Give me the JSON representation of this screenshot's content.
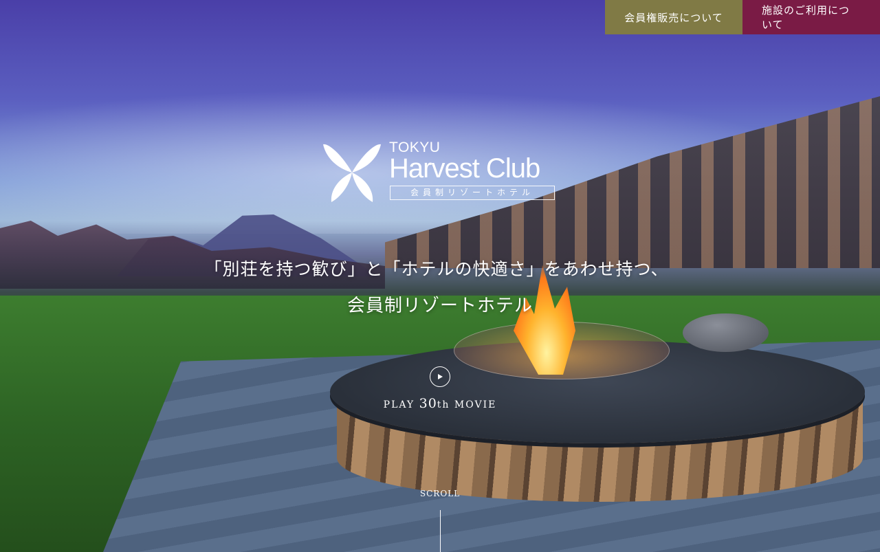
{
  "nav": {
    "membership_label": "会員権販売について",
    "facility_label": "施設のご利用について",
    "membership_color": "#807a45",
    "facility_color": "#7a1b45"
  },
  "logo": {
    "brand_top": "TOKYU",
    "brand_name": "Harvest Club",
    "tagline": "会員制リゾートホテル",
    "icon": "butterfly-logo-icon"
  },
  "hero": {
    "catch_line1": "「別荘を持つ歓び」と「ホテルの快適さ」をあわせ持つ、",
    "catch_line2": "会員制リゾートホテル"
  },
  "movie": {
    "icon": "play-icon",
    "label_prefix": "PLAY ",
    "label_number": "30",
    "label_suffix": "th",
    "label_tail": " MOVIE"
  },
  "scroll": {
    "label": "SCROLL"
  }
}
